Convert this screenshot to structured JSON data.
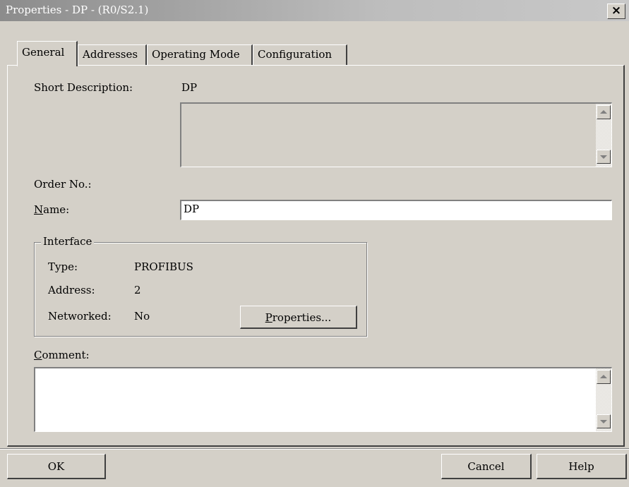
{
  "window": {
    "title": "Properties - DP - (R0/S2.1)",
    "close_glyph": "×"
  },
  "tabs": [
    {
      "label": "General",
      "active": true
    },
    {
      "label": "Addresses",
      "active": false
    },
    {
      "label": "Operating Mode",
      "active": false
    },
    {
      "label": "Configuration",
      "active": false
    }
  ],
  "general": {
    "short_description_label": "Short Description:",
    "short_description_value": "DP",
    "description_text": "",
    "order_no_label": "Order No.:",
    "order_no_value": "",
    "name_label_mnemonic": "N",
    "name_label_rest": "ame:",
    "name_value": "DP",
    "interface": {
      "legend": "Interface",
      "type_label": "Type:",
      "type_value": "PROFIBUS",
      "address_label": "Address:",
      "address_value": "2",
      "networked_label": "Networked:",
      "networked_value": "No",
      "properties_button_pre": "P",
      "properties_button_rest": "roperties..."
    },
    "comment_label_mnemonic": "C",
    "comment_label_rest": "omment:",
    "comment_value": ""
  },
  "footer": {
    "ok_label": "OK",
    "cancel_label": "Cancel",
    "help_label": "Help"
  }
}
